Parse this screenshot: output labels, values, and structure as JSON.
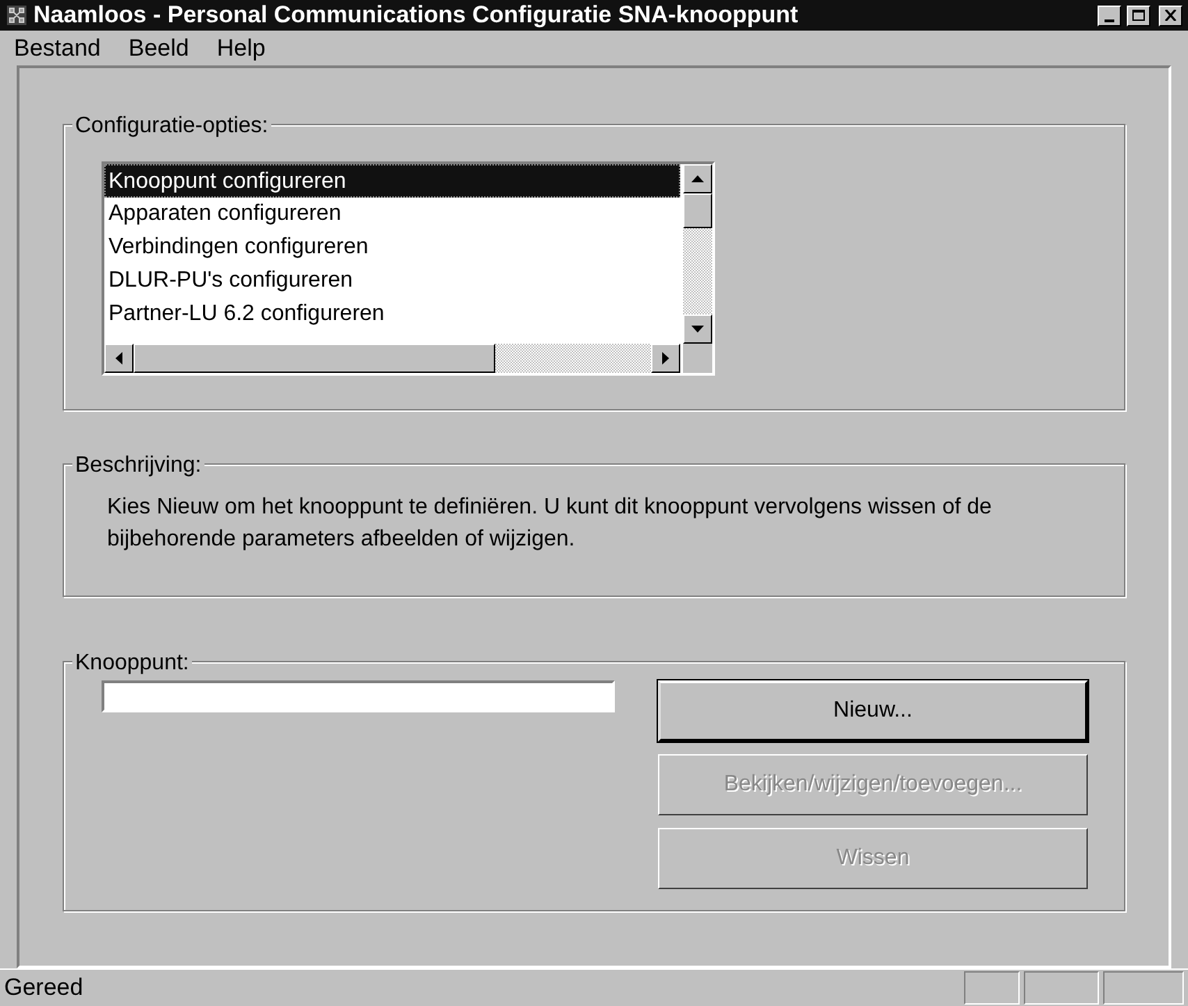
{
  "window": {
    "title": "Naamloos - Personal Communications Configuratie SNA-knooppunt"
  },
  "menu": [
    "Bestand",
    "Beeld",
    "Help"
  ],
  "options_group": {
    "label": "Configuratie-opties:",
    "items": [
      {
        "label": "Knooppunt configureren",
        "selected": true
      },
      {
        "label": "Apparaten configureren",
        "selected": false
      },
      {
        "label": "Verbindingen configureren",
        "selected": false
      },
      {
        "label": "DLUR-PU's configureren",
        "selected": false
      },
      {
        "label": "Partner-LU 6.2 configureren",
        "selected": false
      }
    ]
  },
  "description_group": {
    "label": "Beschrijving:",
    "text": "Kies Nieuw om het knooppunt te definiëren. U kunt dit knooppunt vervolgens wissen of de bijbehorende parameters afbeelden of wijzigen."
  },
  "node_group": {
    "label": "Knooppunt:",
    "buttons": [
      {
        "label": "Nieuw...",
        "disabled": false,
        "default": true
      },
      {
        "label": "Bekijken/wijzigen/toevoegen...",
        "disabled": true,
        "default": false
      },
      {
        "label": "Wissen",
        "disabled": true,
        "default": false
      }
    ]
  },
  "status_bar": {
    "text": "Gereed"
  }
}
